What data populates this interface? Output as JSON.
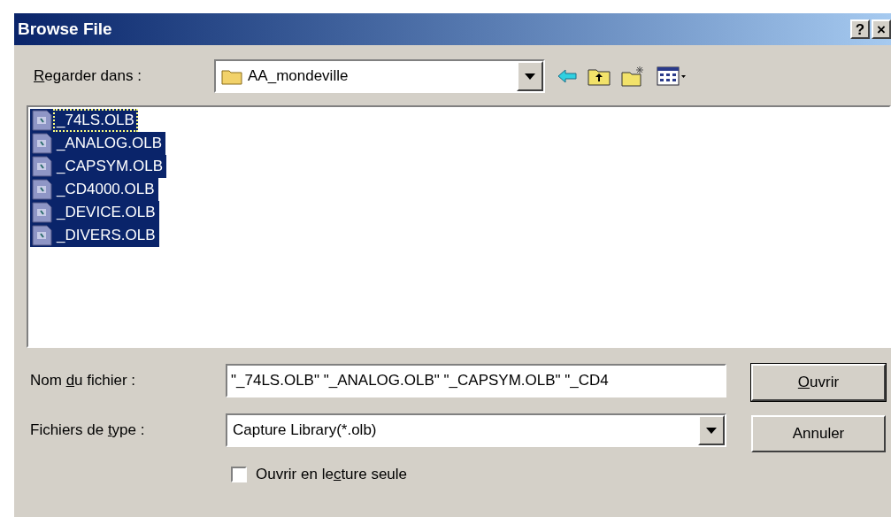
{
  "window": {
    "title": "Browse File",
    "title_buttons": [
      "?",
      "×"
    ]
  },
  "look_in": {
    "label_parts": {
      "key": "R",
      "after": "egarder dans :"
    },
    "value": "AA_mondeville"
  },
  "files": [
    {
      "name": "_74LS.OLB",
      "selected": true,
      "focused": true
    },
    {
      "name": "_ANALOG.OLB",
      "selected": true,
      "focused": false
    },
    {
      "name": "_CAPSYM.OLB",
      "selected": true,
      "focused": false
    },
    {
      "name": "_CD4000.OLB",
      "selected": true,
      "focused": false
    },
    {
      "name": "_DEVICE.OLB",
      "selected": true,
      "focused": false
    },
    {
      "name": "_DIVERS.OLB",
      "selected": true,
      "focused": false
    }
  ],
  "file_name": {
    "label_parts": {
      "before": "Nom ",
      "key": "d",
      "after": "u fichier :"
    },
    "value": "\"_74LS.OLB\" \"_ANALOG.OLB\" \"_CAPSYM.OLB\" \"_CD4"
  },
  "file_type": {
    "label_parts": {
      "before": "Fichiers de ",
      "key": "t",
      "after": "ype :"
    },
    "value": "Capture Library(*.olb)"
  },
  "read_only": {
    "label_parts": {
      "before": "Ouvrir en le",
      "key": "c",
      "after": "ture seule"
    },
    "checked": false
  },
  "buttons": [
    {
      "label_parts": {
        "key": "O",
        "after": "uvrir"
      },
      "default": true
    },
    {
      "label_parts": {
        "before": "Annuler"
      },
      "default": false
    }
  ]
}
